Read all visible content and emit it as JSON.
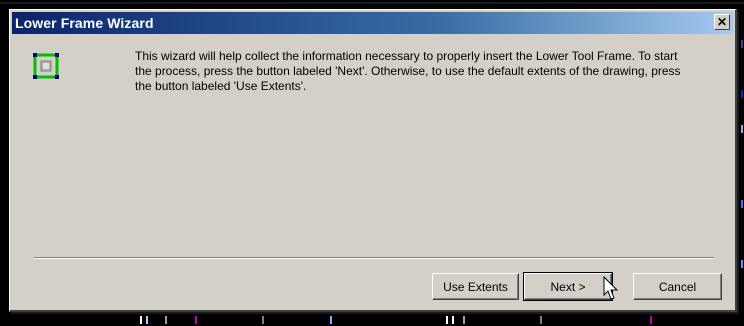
{
  "dialog": {
    "title": "Lower Frame Wizard",
    "close_label": "✕",
    "message": "This wizard will help collect the information necessary to properly insert the Lower Tool Frame.  To start the process, press the button labeled 'Next'.  Otherwise, to use the default extents of the drawing, press the button labeled 'Use Extents'.",
    "icon": "frame-wizard-icon"
  },
  "buttons": {
    "use_extents": "Use Extents",
    "next": "Next >",
    "cancel": "Cancel"
  },
  "colors": {
    "title_start": "#0a246a",
    "title_end": "#a6caf0",
    "face": "#d4d0c8",
    "icon_frame": "#00c000"
  }
}
